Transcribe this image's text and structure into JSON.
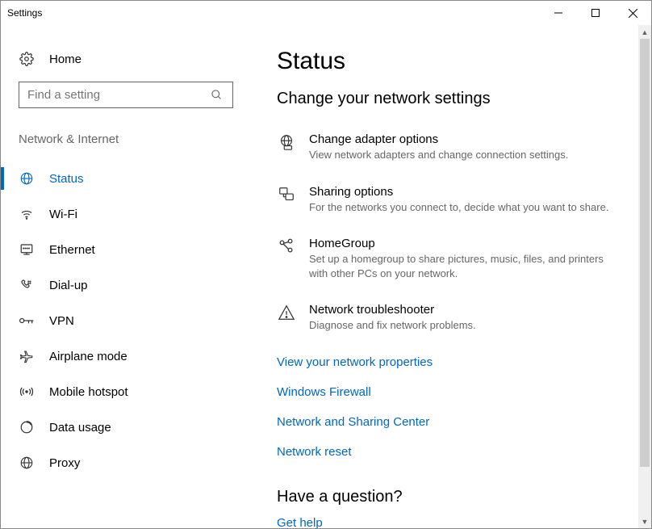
{
  "window": {
    "title": "Settings"
  },
  "home_label": "Home",
  "search": {
    "placeholder": "Find a setting"
  },
  "section_title": "Network & Internet",
  "nav": [
    {
      "label": "Status"
    },
    {
      "label": "Wi-Fi"
    },
    {
      "label": "Ethernet"
    },
    {
      "label": "Dial-up"
    },
    {
      "label": "VPN"
    },
    {
      "label": "Airplane mode"
    },
    {
      "label": "Mobile hotspot"
    },
    {
      "label": "Data usage"
    },
    {
      "label": "Proxy"
    }
  ],
  "page": {
    "title": "Status",
    "heading": "Change your network settings",
    "options": [
      {
        "title": "Change adapter options",
        "sub": "View network adapters and change connection settings."
      },
      {
        "title": "Sharing options",
        "sub": "For the networks you connect to, decide what you want to share."
      },
      {
        "title": "HomeGroup",
        "sub": "Set up a homegroup to share pictures, music, files, and printers with other PCs on your network."
      },
      {
        "title": "Network troubleshooter",
        "sub": "Diagnose and fix network problems."
      }
    ],
    "links": [
      "View your network properties",
      "Windows Firewall",
      "Network and Sharing Center",
      "Network reset"
    ],
    "question": "Have a question?",
    "gethelp": "Get help"
  }
}
